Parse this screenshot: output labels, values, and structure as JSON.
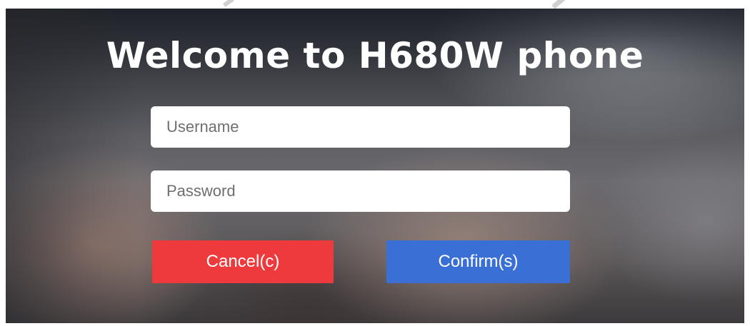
{
  "login": {
    "title": "Welcome to H680W phone",
    "username": {
      "value": "",
      "placeholder": "Username"
    },
    "password": {
      "value": "",
      "placeholder": "Password"
    },
    "cancel_label": "Cancel(c)",
    "confirm_label": "Confirm(s)"
  },
  "colors": {
    "cancel": "#ef3a3d",
    "confirm": "#3a6fd6",
    "title_text": "#ffffff"
  }
}
